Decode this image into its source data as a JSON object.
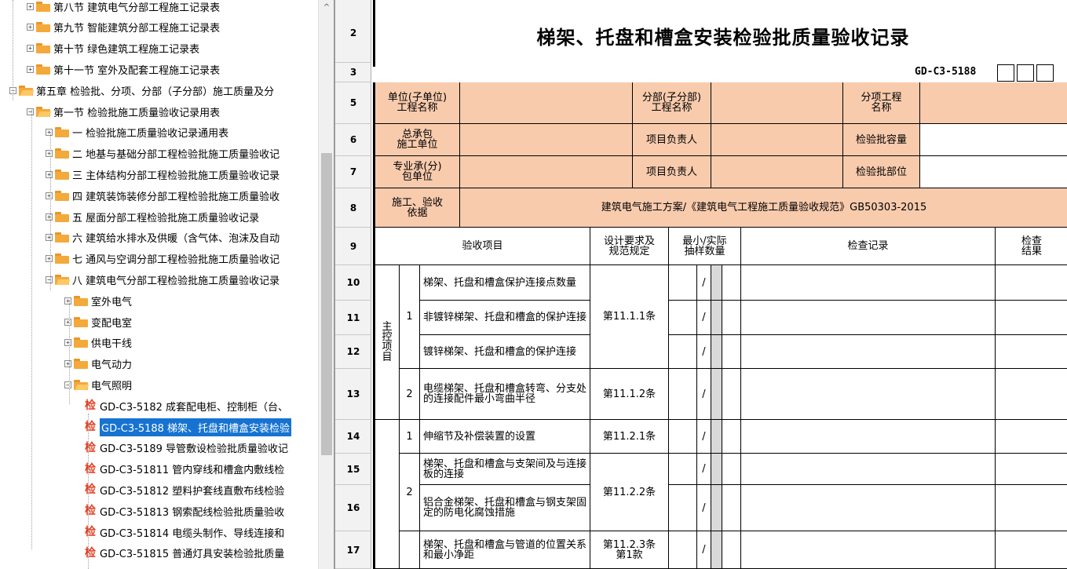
{
  "tree": {
    "items": [
      {
        "label": "第八节 建筑电气分部工程施工记录表",
        "level": 2,
        "type": "folder",
        "expanded": false
      },
      {
        "label": "第九节 智能建筑分部工程施工记录表",
        "level": 2,
        "type": "folder",
        "expanded": false
      },
      {
        "label": "第十节 绿色建筑工程施工记录表",
        "level": 2,
        "type": "folder",
        "expanded": false
      },
      {
        "label": "第十一节 室外及配套工程施工记录表",
        "level": 2,
        "type": "folder",
        "expanded": false
      },
      {
        "label": "第五章 检验批、分项、分部（子分部）施工质量及分",
        "level": 1,
        "type": "folder",
        "expanded": true
      },
      {
        "label": "第一节 检验批施工质量验收记录用表",
        "level": 2,
        "type": "folder",
        "expanded": true
      },
      {
        "label": "一 检验批施工质量验收记录通用表",
        "level": 3,
        "type": "folder",
        "expanded": false
      },
      {
        "label": "二 地基与基础分部工程检验批施工质量验收记",
        "level": 3,
        "type": "folder",
        "expanded": false
      },
      {
        "label": "三 主体结构分部工程检验批施工质量验收记录",
        "level": 3,
        "type": "folder",
        "expanded": false
      },
      {
        "label": "四 建筑装饰装修分部工程检验批施工质量验收",
        "level": 3,
        "type": "folder",
        "expanded": false
      },
      {
        "label": "五 屋面分部工程检验批施工质量验收记录",
        "level": 3,
        "type": "folder",
        "expanded": false
      },
      {
        "label": "六 建筑给水排水及供暖（含气体、泡沫及自动",
        "level": 3,
        "type": "folder",
        "expanded": false
      },
      {
        "label": "七 通风与空调分部工程检验批施工质量验收记",
        "level": 3,
        "type": "folder",
        "expanded": false
      },
      {
        "label": "八 建筑电气分部工程检验批施工质量验收记录",
        "level": 3,
        "type": "folder",
        "expanded": true
      },
      {
        "label": "室外电气",
        "level": 4,
        "type": "folder",
        "expanded": false
      },
      {
        "label": "变配电室",
        "level": 4,
        "type": "folder",
        "expanded": false
      },
      {
        "label": "供电干线",
        "level": 4,
        "type": "folder",
        "expanded": false
      },
      {
        "label": "电气动力",
        "level": 4,
        "type": "folder",
        "expanded": false
      },
      {
        "label": "电气照明",
        "level": 4,
        "type": "folder",
        "expanded": true
      },
      {
        "label": "GD-C3-5182 成套配电柜、控制柜（台、",
        "level": 5,
        "type": "doc"
      },
      {
        "label": "GD-C3-5188 梯架、托盘和槽盒安装检验",
        "level": 5,
        "type": "doc",
        "selected": true
      },
      {
        "label": "GD-C3-5189 导管敷设检验批质量验收记",
        "level": 5,
        "type": "doc"
      },
      {
        "label": "GD-C3-51811 管内穿线和槽盒内敷线检",
        "level": 5,
        "type": "doc"
      },
      {
        "label": "GD-C3-51812 塑料护套线直敷布线检验",
        "level": 5,
        "type": "doc"
      },
      {
        "label": "GD-C3-51813 钢索配线检验批质量验收",
        "level": 5,
        "type": "doc"
      },
      {
        "label": "GD-C3-51814 电缆头制作、导线连接和",
        "level": 5,
        "type": "doc"
      },
      {
        "label": "GD-C3-51815 普通灯具安装检验批质量",
        "level": 5,
        "type": "doc"
      }
    ],
    "doc_icon_glyph": "检",
    "scroll_up_glyph": "^"
  },
  "sheet": {
    "title": "梯架、托盘和槽盒安装检验批质量验收记录",
    "code": "GD-C3-5188",
    "row_numbers": [
      "2",
      "3",
      "5",
      "6",
      "7",
      "8",
      "9",
      "10",
      "11",
      "12",
      "13",
      "14",
      "15",
      "16",
      "17"
    ],
    "header": {
      "unit_project": "单位(子单位)\n工程名称",
      "sub_project": "分部(子分部)\n工程名称",
      "item_project": "分项工程\n名称",
      "contractor": "总承包\n施工单位",
      "project_lead": "项目负责人",
      "batch_capacity": "检验批容量",
      "subcontractor": "专业承(分)\n包单位",
      "project_lead_2": "项目负责人",
      "batch_location": "检验批部位",
      "basis_label": "施工、验收\n依据",
      "basis_value": "建筑电气施工方案/《建筑电气工程施工质量验收规范》GB50303-2015"
    },
    "columns": {
      "item": "验收项目",
      "design": "设计要求及\n规范规定",
      "sample": "最小/实际\n抽样数量",
      "record": "检查记录",
      "result": "检查\n结果"
    },
    "main_control_label": "主\n控\n项\n目",
    "slash": "/",
    "rows": [
      {
        "no": "",
        "text": "梯架、托盘和槽盒保护连接点数量",
        "clause": ""
      },
      {
        "no": "1",
        "text": "非镀锌梯架、托盘和槽盒的保护连接",
        "clause": "第11.1.1条"
      },
      {
        "no": "",
        "text": "镀锌梯架、托盘和槽盒的保护连接",
        "clause": ""
      },
      {
        "no": "2",
        "text": "电缆梯架、托盘和槽盒转弯、分支处的连接配件最小弯曲半径",
        "clause": "第11.1.2条"
      },
      {
        "no": "1",
        "text": "伸缩节及补偿装置的设置",
        "clause": "第11.2.1条"
      },
      {
        "no": "",
        "text": "梯架、托盘和槽盒与支架间及与连接板的连接",
        "clause": ""
      },
      {
        "no": "2",
        "text": "铝合金梯架、托盘和槽盒与钢支架固定的防电化腐蚀措施",
        "clause": "第11.2.2条"
      },
      {
        "no": "",
        "text": "梯架、托盘和槽盒与管道的位置关系和最小净距",
        "clause": "第11.2.3条\n第1款"
      }
    ]
  }
}
